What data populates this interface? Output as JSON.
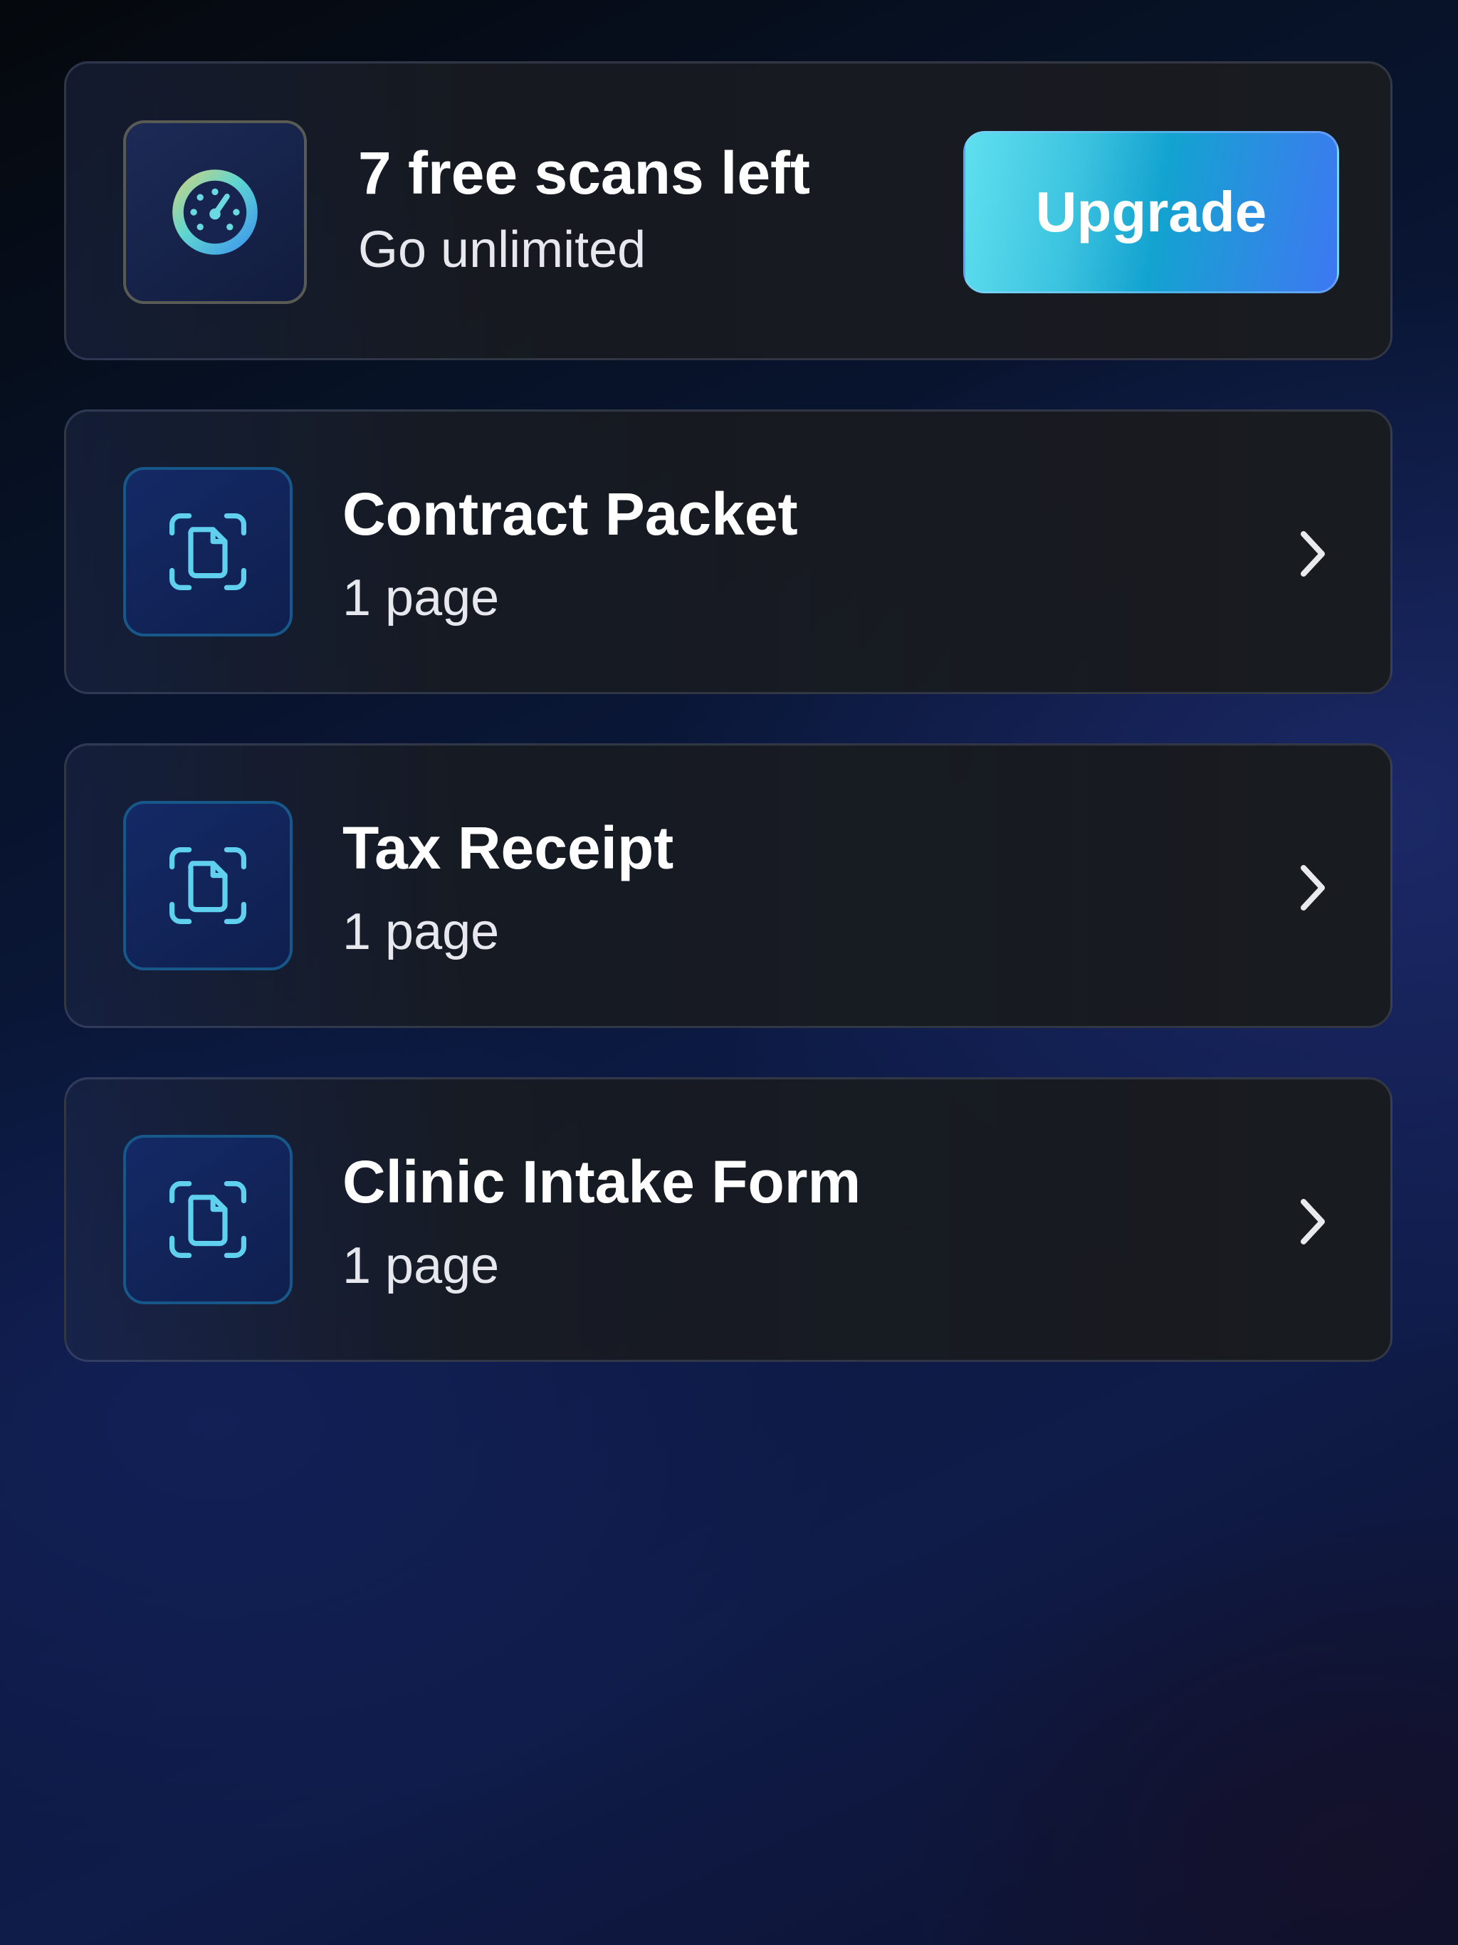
{
  "promo": {
    "icon": "speedometer-icon",
    "title": "7 free scans left",
    "subtitle": "Go unlimited",
    "upgrade_label": "Upgrade"
  },
  "documents": [
    {
      "title": "Contract Packet",
      "pages": "1 page",
      "icon": "document-scan-icon"
    },
    {
      "title": "Tax Receipt",
      "pages": "1 page",
      "icon": "document-scan-icon"
    },
    {
      "title": "Clinic Intake Form",
      "pages": "1 page",
      "icon": "document-scan-icon"
    }
  ],
  "colors": {
    "accent_cyan": "#5fe0ef",
    "accent_blue": "#3d78f2",
    "icon_cyan": "#5fd0ee",
    "card_bg": "#181b1f"
  }
}
